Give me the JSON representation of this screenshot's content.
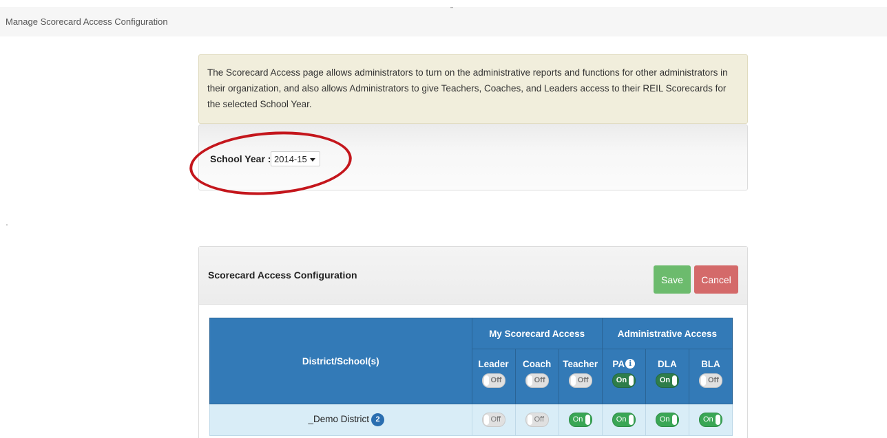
{
  "breadcrumb": "Manage Scorecard Access Configuration",
  "info_text": "The Scorecard Access page allows administrators to turn on the administrative reports and functions for other administrators in their organization, and also allows Administrators to give Teachers, Coaches, and Leaders access to their REIL Scorecards for the selected School Year.",
  "school_year": {
    "label": "School Year :",
    "value": "2014-15"
  },
  "config": {
    "title": "Scorecard Access Configuration",
    "save_label": "Save",
    "cancel_label": "Cancel"
  },
  "table": {
    "name_header": "District/School(s)",
    "groups": {
      "my_scorecard": "My Scorecard Access",
      "administrative": "Administrative Access"
    },
    "columns": {
      "leader": "Leader",
      "coach": "Coach",
      "teacher": "Teacher",
      "pa": "PA",
      "dla": "DLA",
      "bla": "BLA"
    },
    "header_toggles": {
      "leader": "Off",
      "coach": "Off",
      "teacher": "Off",
      "pa": "On",
      "dla": "On",
      "bla": "Off"
    },
    "rows": [
      {
        "name": "_Demo District",
        "badge": "2",
        "leader": "Off",
        "coach": "Off",
        "teacher": "On",
        "pa": "On",
        "dla": "On",
        "bla": "On"
      }
    ]
  },
  "icons": {
    "pa_info": "info-circle-icon"
  },
  "colors": {
    "header_blue": "#337ab7",
    "save_green": "#6cbb6d",
    "cancel_red": "#d46a6a",
    "highlight_oval": "#c4161c"
  }
}
